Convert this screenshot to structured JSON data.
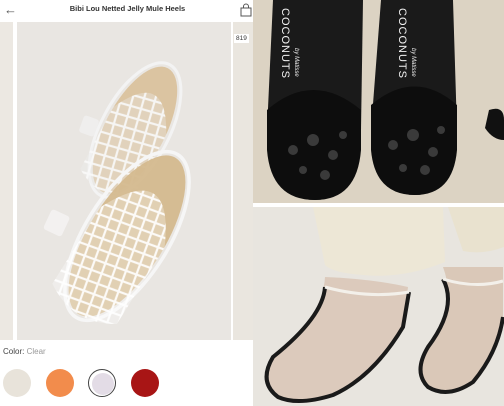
{
  "header": {
    "title": "Bibi Lou Netted Jelly Mule Heels",
    "back_icon": "back-arrow-icon",
    "bag_icon": "shopping-bag-icon"
  },
  "gallery": {
    "badge": "819"
  },
  "color": {
    "label": "Color:",
    "value": "Clear"
  },
  "swatches": [
    {
      "name": "nude",
      "color": "#e8e3da"
    },
    {
      "name": "orange",
      "color": "#f28c4c"
    },
    {
      "name": "clear",
      "color": "#e3dce6",
      "selected": true
    },
    {
      "name": "red",
      "color": "#a81515"
    }
  ],
  "photos": {
    "top_right": {
      "brand_left": "COCONUTS",
      "brand_left_sub": "by Matisse",
      "brand_right": "COCONUTS",
      "brand_right_sub": "by Matisse"
    }
  },
  "colors": {
    "accent": "#888888",
    "page_bg": "#ffffff"
  }
}
